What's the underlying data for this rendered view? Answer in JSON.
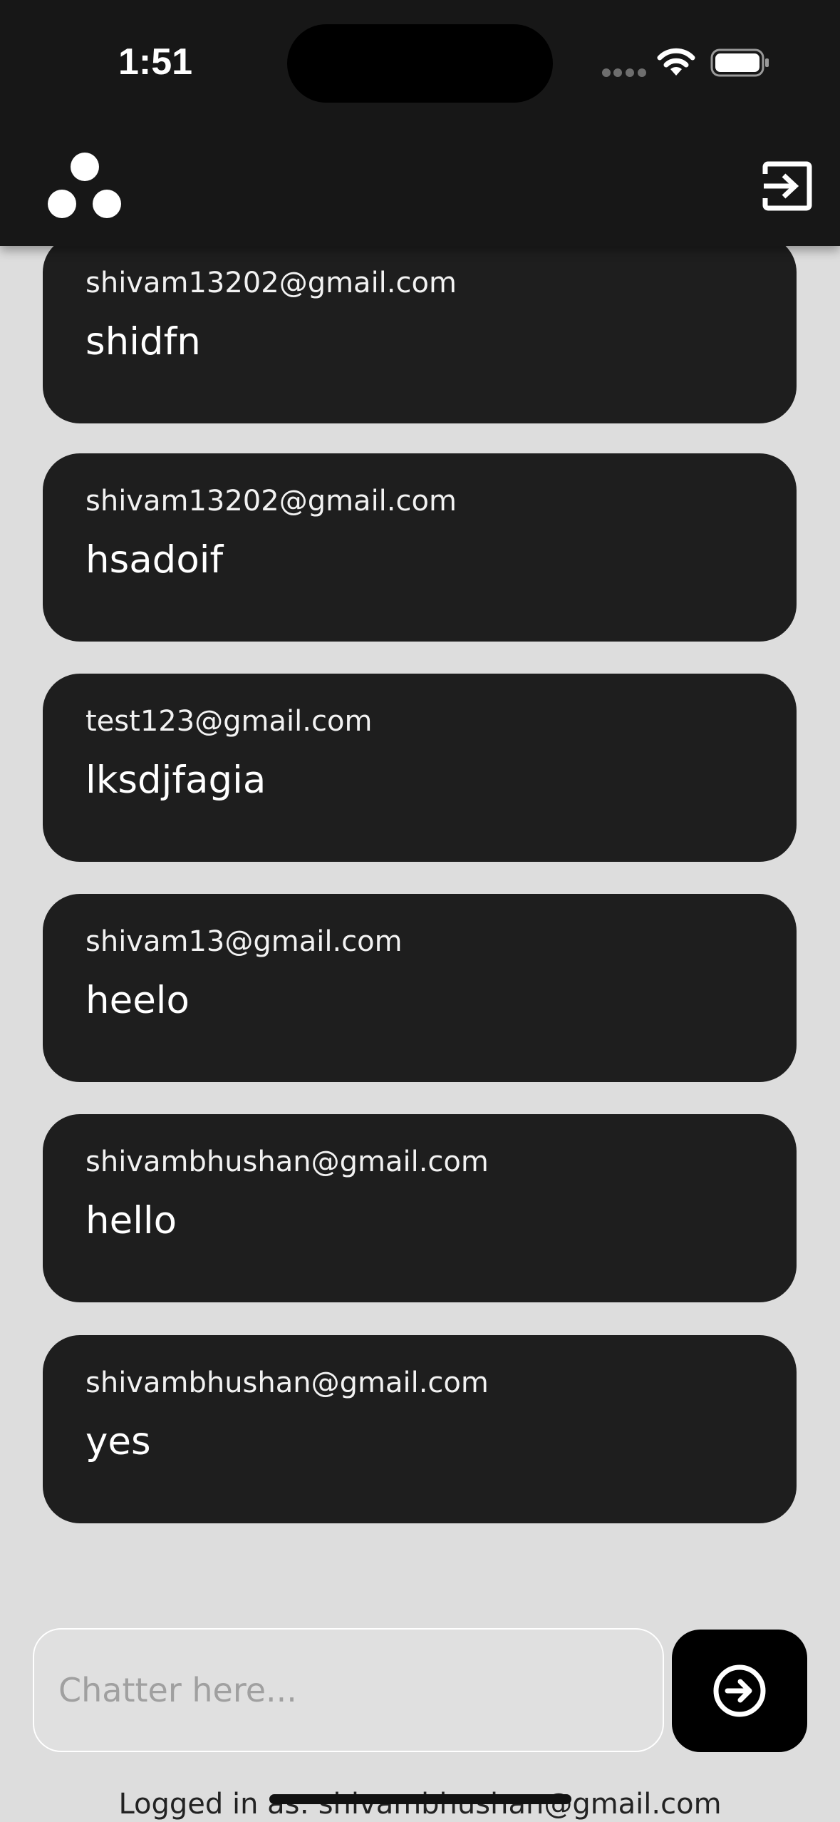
{
  "status_bar": {
    "time": "1:51"
  },
  "header": {
    "logo_icon": "three-dots-logo-icon",
    "logout_icon": "logout-icon"
  },
  "messages": [
    {
      "email": "shivam13202@gmail.com",
      "text": "shidfn"
    },
    {
      "email": "shivam13202@gmail.com",
      "text": "hsadoif"
    },
    {
      "email": "test123@gmail.com",
      "text": "lksdjfagia"
    },
    {
      "email": "shivam13@gmail.com",
      "text": "heelo"
    },
    {
      "email": "shivambhushan@gmail.com",
      "text": "hello"
    },
    {
      "email": "shivambhushan@gmail.com",
      "text": "yes"
    }
  ],
  "composer": {
    "placeholder": "Chatter here...",
    "value": "",
    "send_icon": "arrow-right-circle-icon"
  },
  "footer": {
    "logged_in_text": "Logged in as: shivambhushan@gmail.com"
  },
  "colors": {
    "background": "#dddddd",
    "bubble": "#1e1e1e",
    "header": "#171717",
    "send_button": "#000000"
  }
}
